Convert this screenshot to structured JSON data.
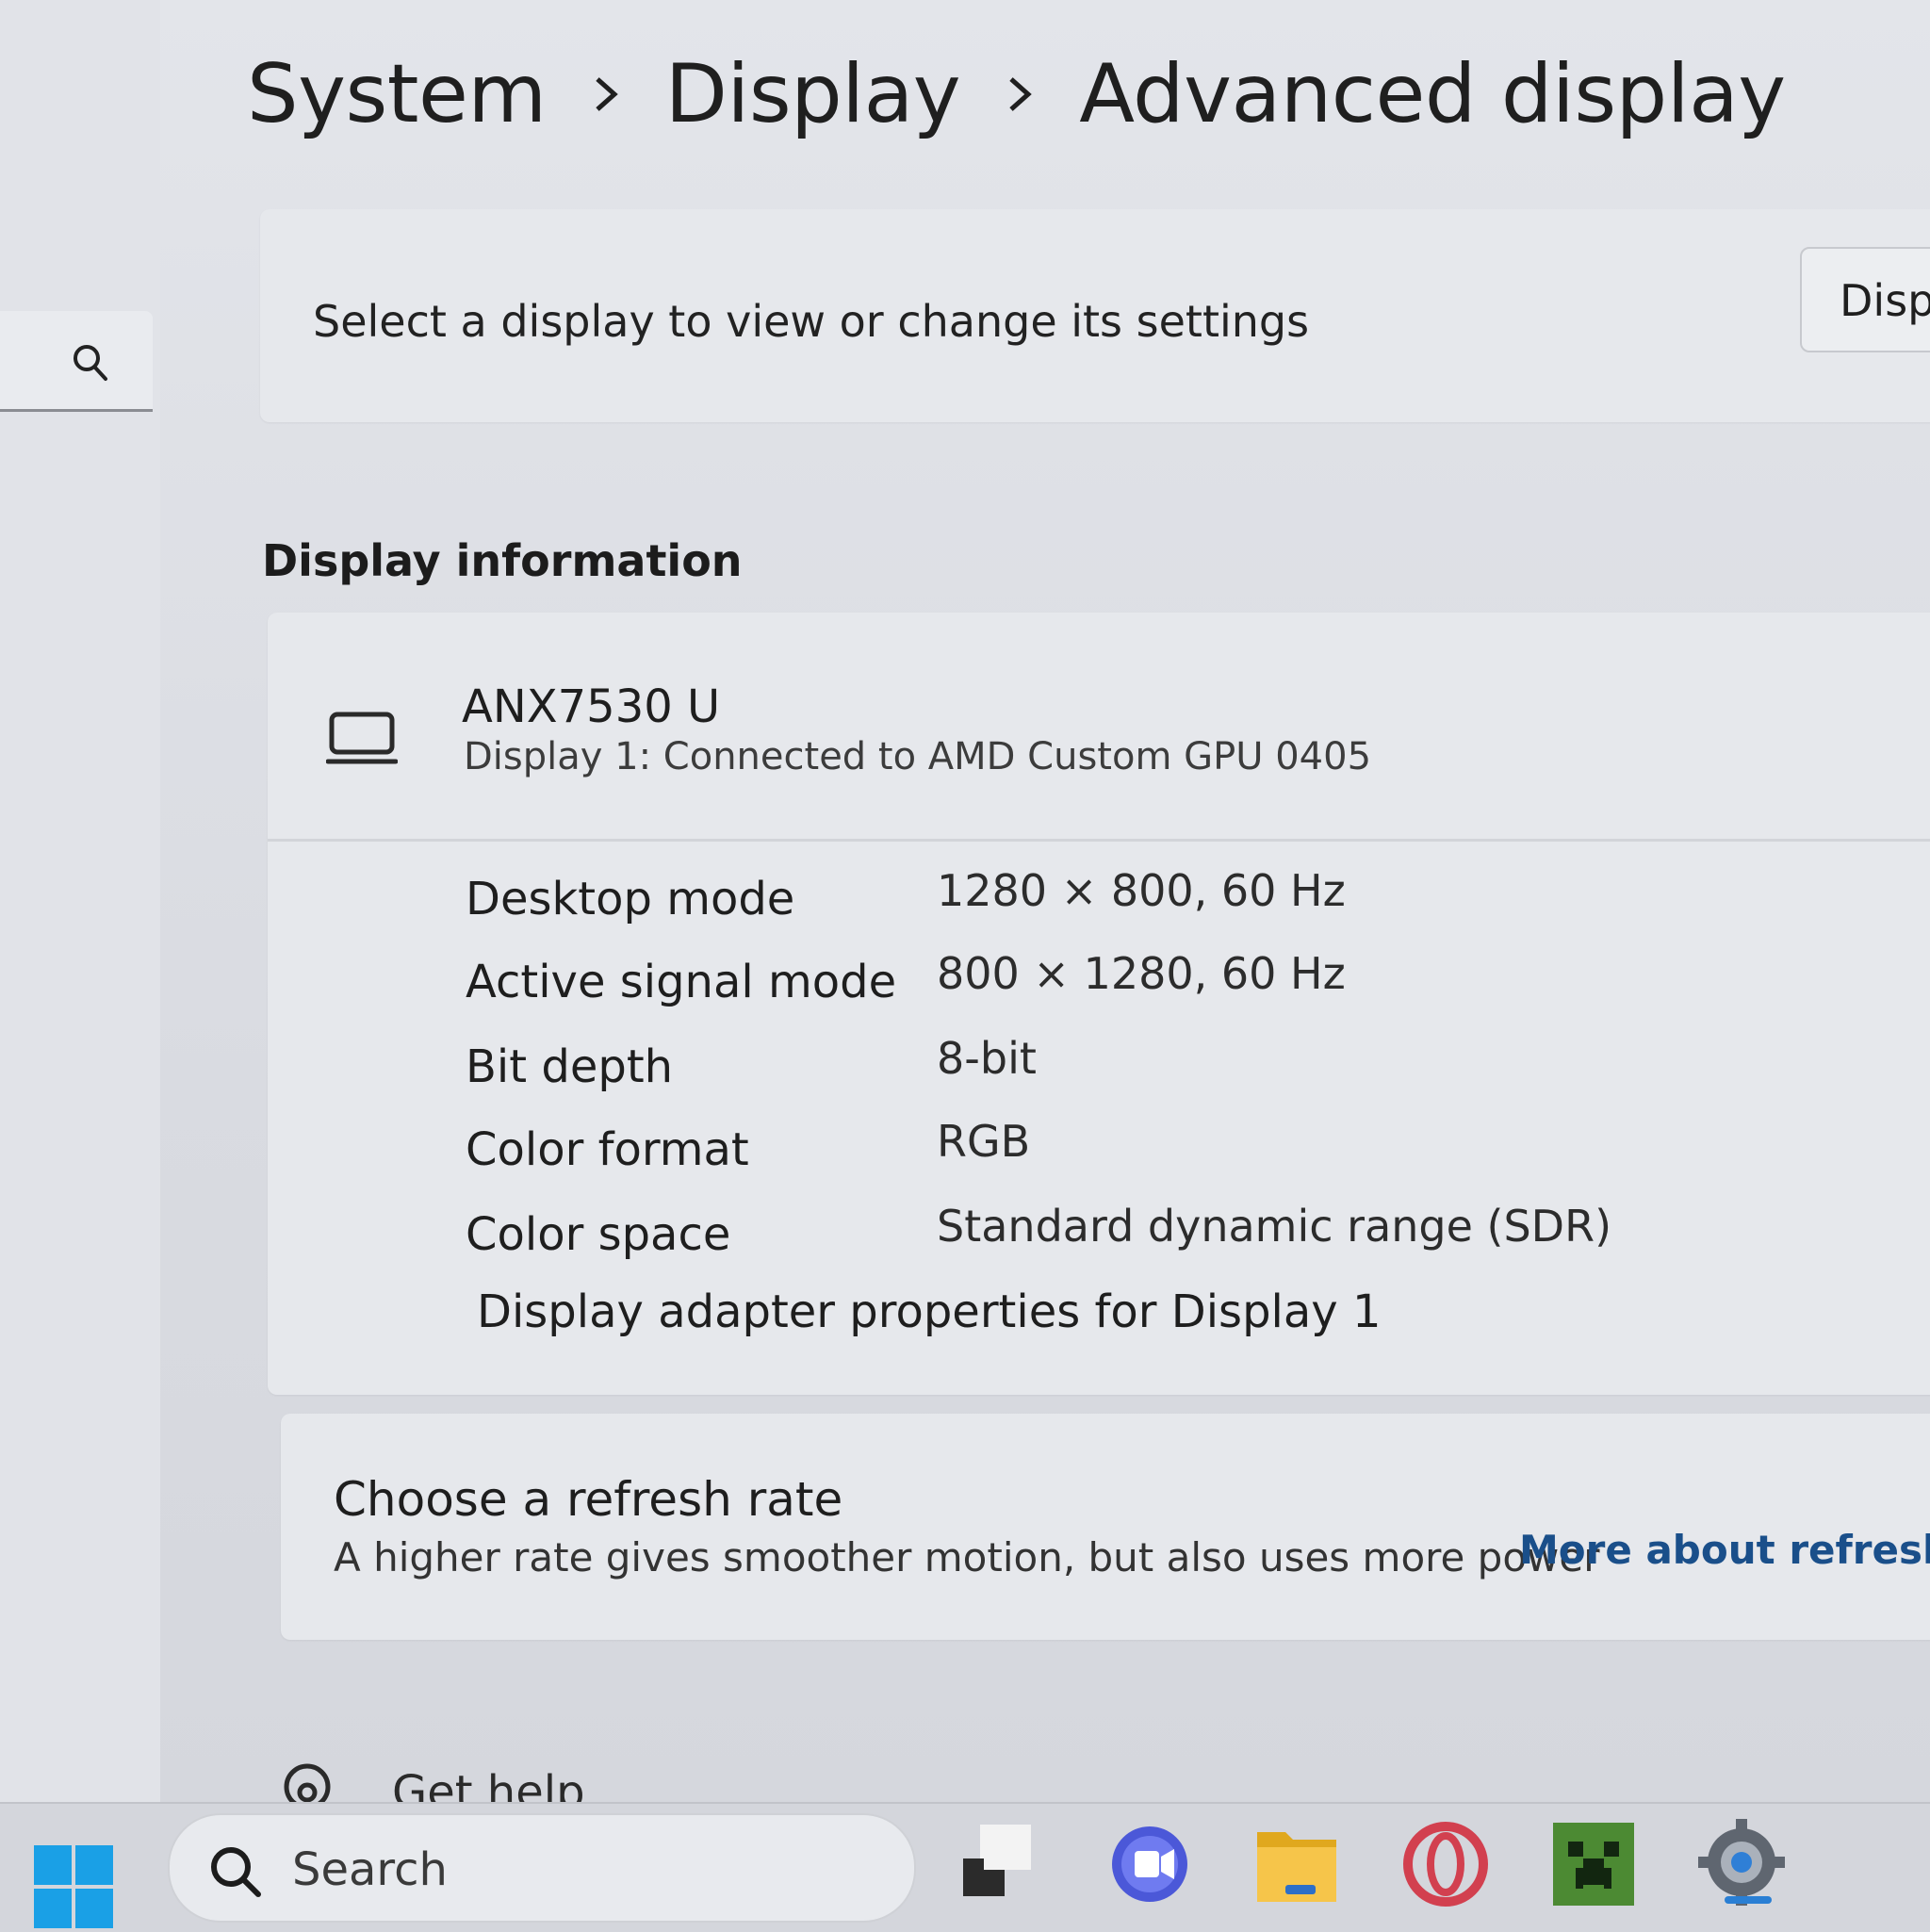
{
  "breadcrumb": {
    "items": [
      "System",
      "Display",
      "Advanced display"
    ]
  },
  "select_display": {
    "label": "Select a display to view or change its settings",
    "button_label": "Disp"
  },
  "display_information": {
    "section_title": "Display information",
    "monitor_name": "ANX7530 U",
    "monitor_subtitle": "Display 1: Connected to AMD Custom GPU 0405",
    "rows": [
      {
        "key": "Desktop mode",
        "value": "1280 × 800, 60 Hz"
      },
      {
        "key": "Active signal mode",
        "value": "800 × 1280, 60 Hz"
      },
      {
        "key": "Bit depth",
        "value": "8-bit"
      },
      {
        "key": "Color format",
        "value": "RGB"
      },
      {
        "key": "Color space",
        "value": "Standard dynamic range (SDR)"
      }
    ],
    "adapter_link": "Display adapter properties for Display 1"
  },
  "refresh_rate": {
    "title": "Choose a refresh rate",
    "description": "A higher rate gives smoother motion, but also uses more power",
    "more_link": "More about refresh ra"
  },
  "get_help": {
    "label": "Get help"
  },
  "taskbar": {
    "search_placeholder": "Search",
    "apps": [
      "task-view-icon",
      "meet-icon",
      "file-explorer-icon",
      "opera-icon",
      "minecraft-icon",
      "settings-icon"
    ]
  },
  "colors": {
    "accent": "#1aa0e6",
    "link": "#1a4f8a",
    "background": "#dcdee3"
  }
}
